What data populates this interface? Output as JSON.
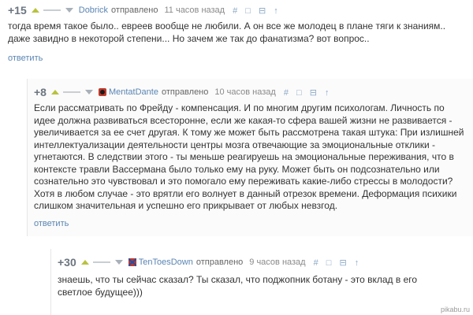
{
  "comments": [
    {
      "rating": "+15",
      "author": "Dobrick",
      "sent_label": "отправлено",
      "time": "11 часов назад",
      "tools": [
        "#",
        "□",
        "⊟",
        "↑"
      ],
      "text": "тогда время такое было.. евреев вообще не любили. А он все же молодец в плане тяги к знаниям.. даже завидно в некоторой степени... Но зачем же так до фанатизма? вот вопрос..",
      "reply_label": "ответить"
    },
    {
      "rating": "+8",
      "author": "MentatDante",
      "sent_label": "отправлено",
      "time": "10 часов назад",
      "tools": [
        "#",
        "□",
        "⊟",
        "↑"
      ],
      "text": "Если рассматривать по Фрейду - компенсация. И по многим другим психологам. Личность по идее должна развиваться всесторонне, если же какая-то сфера вашей жизни не развивается - увеличивается за ее счет другая. К тому же может быть рассмотрена такая штука: При излишней интеллектуализации деятельности центры мозга отвечающие за эмоциональные отклики - угнетаются. В следствии этого - ты меньше реагируешь на эмоциональные переживания, что в контексте травли Вассермана было только ему на руку. Может быть он подсознательно или сознательно это чувствовал и это помогало ему переживать какие-либо стрессы в молодости? Хотя в любом случае - это врятли его волнует в данный отрезок времени. Деформация психики слишком значительная и успешно его прикрывает от любых невзгод.",
      "reply_label": "ответить"
    },
    {
      "rating": "+30",
      "author": "TenToesDown",
      "sent_label": "отправлено",
      "time": "9 часов назад",
      "tools": [
        "#",
        "□",
        "⊟",
        "↑"
      ],
      "text": "знаешь, что ты сейчас сказал? Ты сказал, что поджопник ботану - это вклад в его светлое будущее)))"
    }
  ],
  "watermark": "pikabu.ru"
}
